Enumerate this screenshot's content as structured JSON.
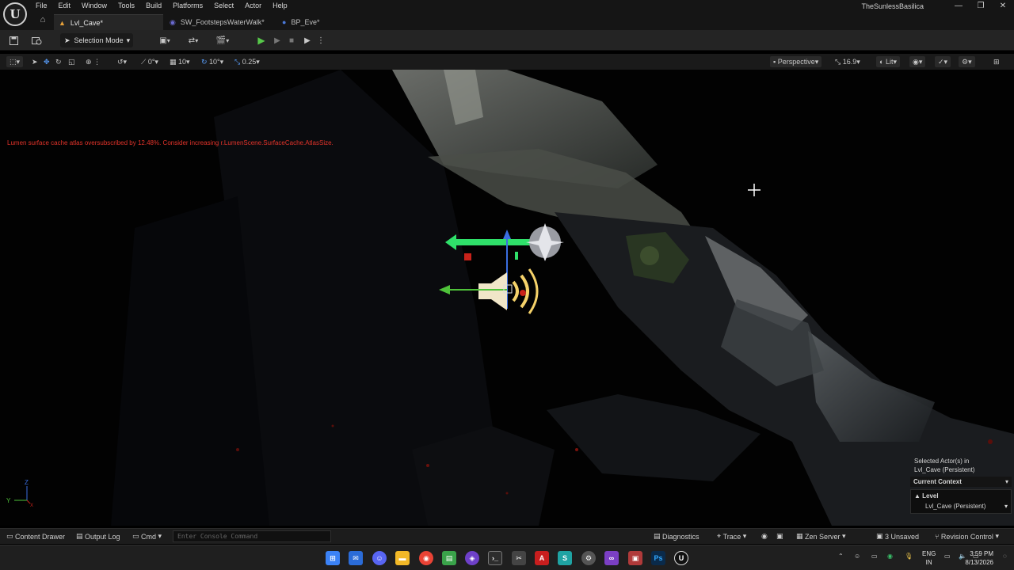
{
  "app": {
    "project_name": "TheSunlessBasilica",
    "logo_letter": "U",
    "window_buttons": [
      "—",
      "❐",
      "✕"
    ]
  },
  "menu": [
    "File",
    "Edit",
    "Window",
    "Tools",
    "Build",
    "Platforms",
    "Select",
    "Actor",
    "Help"
  ],
  "tabs": [
    {
      "label": "Lvl_Cave*",
      "icon": "level-icon",
      "active": true
    },
    {
      "label": "SW_FootstepsWaterWalk*",
      "icon": "soundwave-icon",
      "active": false
    },
    {
      "label": "BP_Eve*",
      "icon": "blueprint-icon",
      "active": false
    }
  ],
  "toolbar": {
    "selection_mode": "Selection Mode"
  },
  "viewport_toolbar": {
    "rotation_snap_value": "0°",
    "grid_snap_value": "10",
    "angle_snap_value": "10°",
    "scale_snap_value": "0.25",
    "perspective_label": "Perspective",
    "camera_speed": "16.9",
    "view_mode": "Lit"
  },
  "viewport": {
    "warning": "Lumen surface cache atlas oversubscribed by 12.48%. Consider increasing r.LumenScene.SurfaceCache.AtlasSize.",
    "axis_z": "Z",
    "axis_y": "Y",
    "axis_x": "X",
    "selection_panel": {
      "selected_line1": "Selected Actor(s) in",
      "selected_line2": "Lvl_Cave (Persistent)",
      "current_context": "Current Context",
      "level_label": "Level",
      "level_value": "Lvl_Cave (Persistent)"
    }
  },
  "statusbar": {
    "content_drawer": "Content Drawer",
    "output_log": "Output Log",
    "cmd": "Cmd",
    "console_placeholder": "Enter Console Command",
    "diagnostics": "Diagnostics",
    "trace": "Trace",
    "zen_server": "Zen Server",
    "unsaved": "3 Unsaved",
    "revision_control": "Revision Control"
  },
  "taskbar": {
    "lang_line1": "ENG",
    "lang_line2": "IN",
    "time": "3:59 PM",
    "date": "8/13/2026"
  },
  "colors": {
    "warning": "#e2332a",
    "gizmo_green": "#2fe06a",
    "gizmo_blue": "#3a6ee0",
    "gizmo_red": "#c8221a",
    "play_green": "#57c84a"
  }
}
